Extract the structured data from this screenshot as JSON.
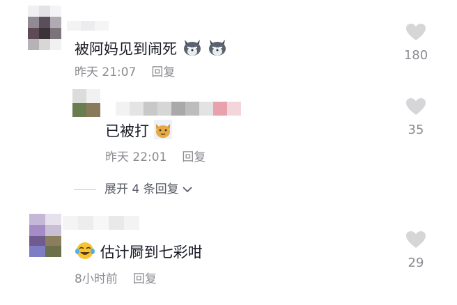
{
  "comments": [
    {
      "text": "被阿妈见到闹死",
      "time": "昨天 21:07",
      "reply_label": "回复",
      "likes": "180",
      "emojis": [
        "wolf-emoji",
        "wolf-emoji"
      ]
    },
    {
      "text": "估计屙到七彩咁",
      "time": "8小时前",
      "reply_label": "回复",
      "likes": "29",
      "emojis": [
        "laugh-cry-emoji"
      ]
    }
  ],
  "reply": {
    "text": "已被打",
    "time": "昨天 22:01",
    "reply_label": "回复",
    "likes": "35",
    "emojis": [
      "cat-emoji"
    ]
  },
  "expand_label": "展开 4 条回复",
  "colors": {
    "text": "#161823",
    "meta": "#8a8b91",
    "heart": "#d6d6d9"
  }
}
